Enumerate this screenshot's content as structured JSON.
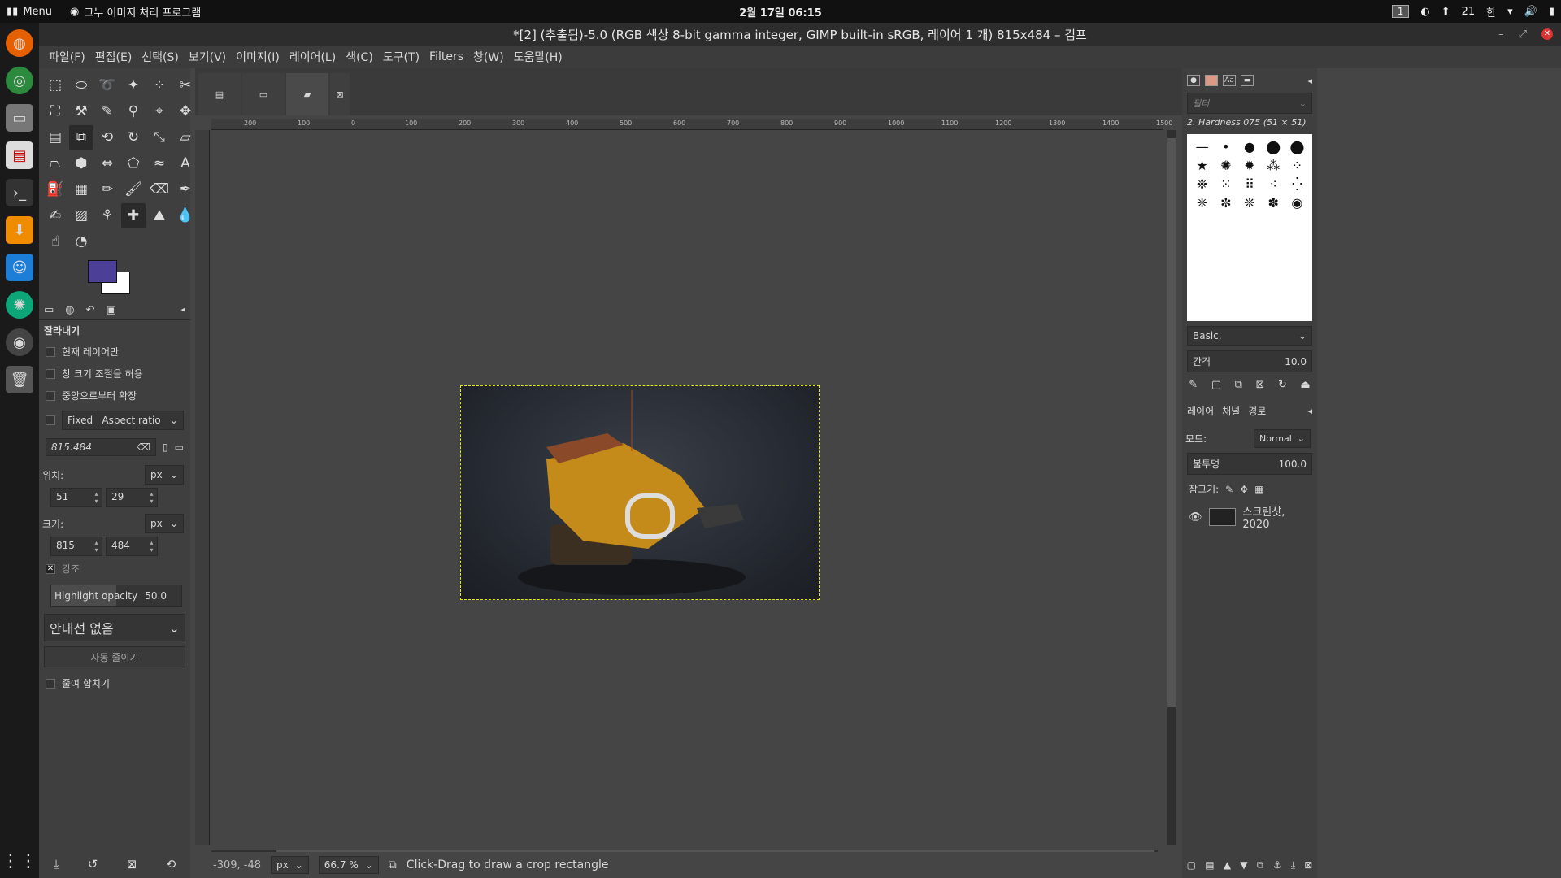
{
  "topbar": {
    "menu_label": "Menu",
    "app_title": "그누 이미지 처리 프로그램",
    "clock": "2월 17일 06:15",
    "workspace": "1",
    "notif_count": "21",
    "ime": "한"
  },
  "window": {
    "title": "*[2] (추출됨)-5.0 (RGB 색상 8-bit gamma integer, GIMP built-in sRGB, 레이어 1 개) 815x484 – 김프"
  },
  "menubar": [
    "파일(F)",
    "편집(E)",
    "선택(S)",
    "보기(V)",
    "이미지(I)",
    "레이어(L)",
    "색(C)",
    "도구(T)",
    "Filters",
    "창(W)",
    "도움말(H)"
  ],
  "tool_options": {
    "title": "잘라내기",
    "current_layer_only": "현재 레이어만",
    "allow_growing": "창 크기 조절을 허용",
    "expand_from_center": "중앙으로부터 확장",
    "fixed_label": "Fixed",
    "fixed_mode": "Aspect ratio",
    "ratio_value": "815:484",
    "position_label": "위치:",
    "position_unit": "px",
    "pos_x": "51",
    "pos_y": "29",
    "size_label": "크기:",
    "size_unit": "px",
    "size_w": "815",
    "size_h": "484",
    "highlight_label": "강조",
    "highlight_opacity_label": "Highlight opacity",
    "highlight_opacity_value": "50.0",
    "highlight_opacity_fraction": 0.5,
    "guides": "안내선 없음",
    "auto_shrink": "자동 줄이기",
    "shrink_merged": "줄여 합치기"
  },
  "colors": {
    "foreground": "#4b3f98",
    "background": "#ffffff"
  },
  "ruler_ticks": [
    "200",
    "100",
    "0",
    "100",
    "200",
    "300",
    "400",
    "500",
    "600",
    "700",
    "800",
    "900",
    "1000",
    "1100",
    "1200",
    "1300",
    "1400",
    "1500"
  ],
  "status": {
    "coords": "-309, -48",
    "unit": "px",
    "zoom": "66.7 %",
    "message": "Click-Drag to draw a crop rectangle"
  },
  "brushes": {
    "filter_placeholder": "필터",
    "current": "2. Hardness 075 (51 × 51)",
    "preset": "Basic,",
    "spacing_label": "간격",
    "spacing_value": "10.0"
  },
  "layers": {
    "tabs": [
      "레이어",
      "채널",
      "경로"
    ],
    "mode_label": "모드:",
    "mode_value": "Normal",
    "opacity_label": "불투명",
    "opacity_value": "100.0",
    "lock_label": "잠그기:",
    "layer_name": "스크린샷, 2020"
  }
}
